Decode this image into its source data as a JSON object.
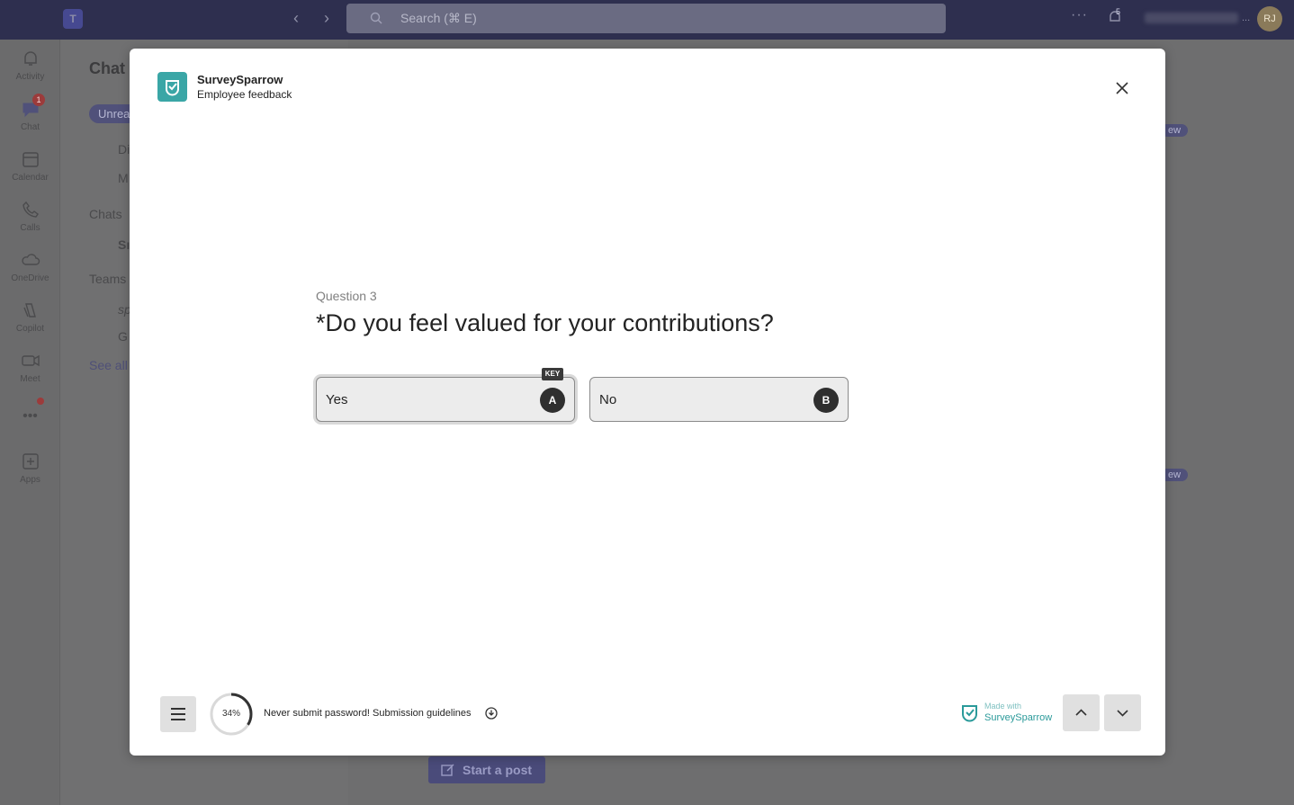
{
  "teams": {
    "search_placeholder": "Search (⌘ E)",
    "notification_count": "5",
    "user_initials": "RJ",
    "rail": [
      {
        "label": "Activity"
      },
      {
        "label": "Chat",
        "badge": "1"
      },
      {
        "label": "Calendar"
      },
      {
        "label": "Calls"
      },
      {
        "label": "OneDrive"
      },
      {
        "label": "Copilot"
      },
      {
        "label": "Meet"
      },
      {
        "label": "Apps"
      }
    ],
    "chat_title": "Chat",
    "filter_pill": "Unrea",
    "chatpane_rows": [
      "Di",
      "M",
      "Chats",
      "Sı",
      "Teams",
      "sp",
      "G",
      "See all"
    ],
    "new_badge": "ew",
    "start_post": "Start a post"
  },
  "modal": {
    "app_name": "SurveySparrow",
    "app_subtitle": "Employee feedback",
    "question_label": "Question 3",
    "question_text": "*Do you feel valued for your contributions?",
    "key_tag": "KEY",
    "options": [
      {
        "label": "Yes",
        "key": "A",
        "selected": true
      },
      {
        "label": "No",
        "key": "B",
        "selected": false
      }
    ],
    "progress": {
      "percent": 34,
      "label": "34%"
    },
    "footer_note": "Never submit password! Submission guidelines",
    "made_with": "Made with",
    "brand": "SurveySparrow",
    "icons": {
      "close": "close-icon",
      "menu": "menu-icon",
      "info": "info-icon",
      "up": "chevron-up-icon",
      "down": "chevron-down-icon"
    },
    "colors": {
      "brand_teal": "#3aa6a6",
      "key_dark": "#2f2f2f"
    }
  }
}
